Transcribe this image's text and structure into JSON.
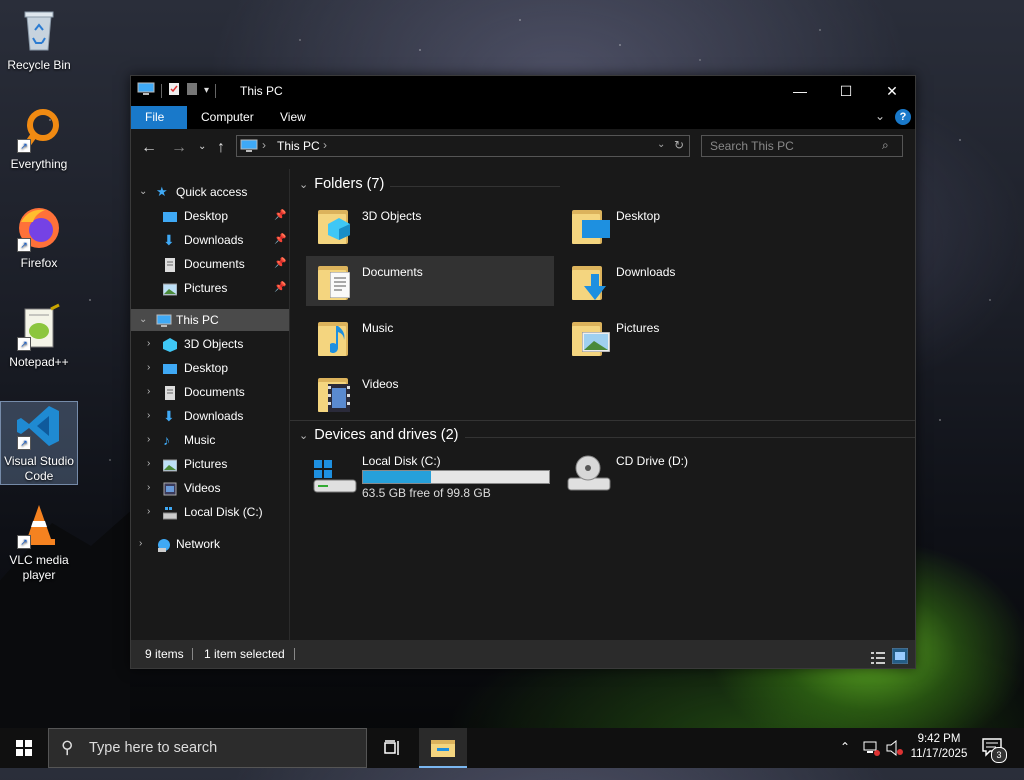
{
  "desktop": {
    "icons": [
      {
        "label": "Recycle Bin"
      },
      {
        "label": "Everything"
      },
      {
        "label": "Firefox"
      },
      {
        "label": "Notepad++"
      },
      {
        "label": "Visual Studio Code"
      },
      {
        "label": "VLC media player"
      }
    ]
  },
  "window": {
    "title": "This PC",
    "minimize": "—",
    "maximize": "☐",
    "close": "✕",
    "ribbon_tabs": [
      "File",
      "Computer",
      "View"
    ],
    "address": {
      "root": "This PC",
      "sep": "›"
    },
    "search_placeholder": "Search This PC"
  },
  "nav": {
    "quick_access": "Quick access",
    "quick_items": [
      "Desktop",
      "Downloads",
      "Documents",
      "Pictures"
    ],
    "this_pc": "This PC",
    "pc_items": [
      "3D Objects",
      "Desktop",
      "Documents",
      "Downloads",
      "Music",
      "Pictures",
      "Videos",
      "Local Disk (C:)"
    ],
    "network": "Network"
  },
  "content": {
    "folders_header": "Folders (7)",
    "folders": [
      "3D Objects",
      "Desktop",
      "Documents",
      "Downloads",
      "Music",
      "Pictures",
      "Videos"
    ],
    "devices_header": "Devices and drives (2)",
    "drive_c": {
      "label": "Local Disk (C:)",
      "free_text": "63.5 GB free of 99.8 GB",
      "used_fraction": 0.364
    },
    "drive_d": {
      "label": "CD Drive (D:)"
    }
  },
  "status": {
    "items": "9 items",
    "selected": "1 item selected"
  },
  "taskbar": {
    "search_placeholder": "Type here to search",
    "time": "9:42 PM",
    "date": "11/17/2025",
    "notifications": "3"
  },
  "colors": {
    "accent": "#1979ca",
    "progress": "#26a0da",
    "folder": "#f4d57f"
  }
}
